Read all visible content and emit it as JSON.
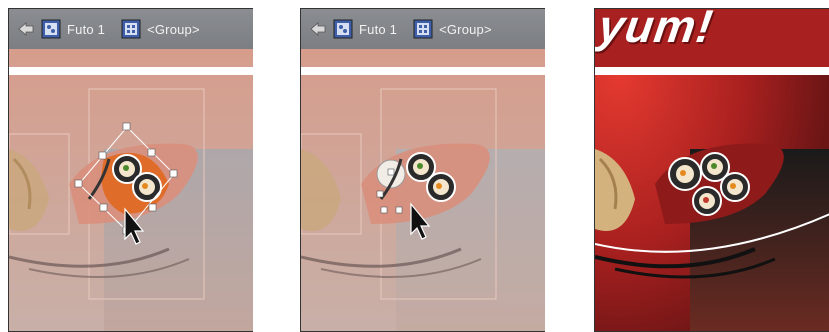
{
  "panels": [
    {
      "breadcrumb": {
        "items": [
          {
            "label": "Futo 1",
            "icon": "layer-icon"
          },
          {
            "label": "<Group>",
            "icon": "group-icon"
          }
        ]
      }
    },
    {
      "breadcrumb": {
        "items": [
          {
            "label": "Futo 1",
            "icon": "layer-icon"
          },
          {
            "label": "<Group>",
            "icon": "group-icon"
          }
        ]
      }
    },
    {
      "headline": "yum!"
    }
  ],
  "colors": {
    "bg_faded": "#cfa08f",
    "bg_red": "#b8262a",
    "plate_red": "#c93a3a",
    "selection_blue": "#ffffff"
  }
}
